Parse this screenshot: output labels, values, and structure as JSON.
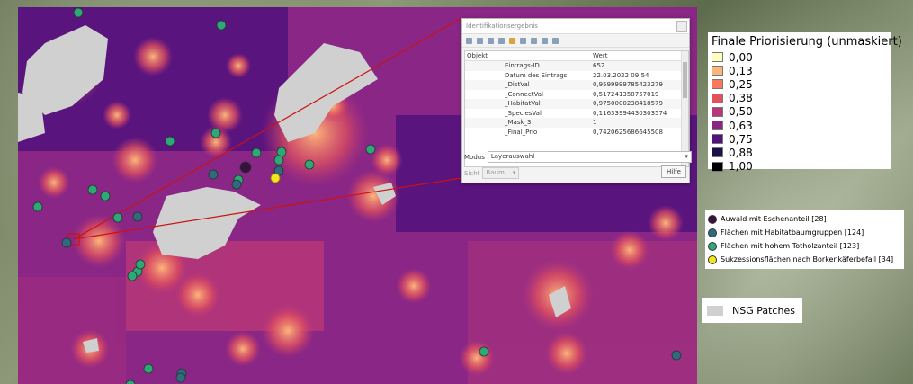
{
  "identify": {
    "title": "Identifikationsergebnis",
    "col_object": "Objekt",
    "col_value": "Wert",
    "rows": [
      {
        "name": "Eintrags-ID",
        "value": "652"
      },
      {
        "name": "Datum des Eintrags",
        "value": "22.03.2022 09:54"
      },
      {
        "name": "_DistVal",
        "value": "0,9599999785423279"
      },
      {
        "name": "_ConnectVal",
        "value": "0,517241358757019"
      },
      {
        "name": "_HabitatVal",
        "value": "0,9750000238418579"
      },
      {
        "name": "_SpeciesVal",
        "value": "0,11633994430303574"
      },
      {
        "name": "_Mask_3",
        "value": "1"
      },
      {
        "name": "_Final_Prio",
        "value": "0,7420625686645508"
      }
    ],
    "mode_label": "Modus",
    "mode_value": "Layerauswahl",
    "view_label": "Sicht",
    "view_value": "Baum",
    "help_label": "Hilfe"
  },
  "legend_prio": {
    "title": "Finale Priorisierung (unmaskiert)",
    "items": [
      {
        "label": "0,00",
        "color": "#fcfdbf"
      },
      {
        "label": "0,13",
        "color": "#fdb57a"
      },
      {
        "label": "0,25",
        "color": "#f9795d"
      },
      {
        "label": "0,38",
        "color": "#e3515c"
      },
      {
        "label": "0,50",
        "color": "#b73779"
      },
      {
        "label": "0,63",
        "color": "#8a2685"
      },
      {
        "label": "0,75",
        "color": "#51127c"
      },
      {
        "label": "0,88",
        "color": "#1d1147"
      },
      {
        "label": "1,00",
        "color": "#000004"
      }
    ]
  },
  "legend_points": {
    "items": [
      {
        "label": "Auwald mit Eschenanteil [28]",
        "color": "#3b0f3f"
      },
      {
        "label": "Flächen mit Habitatbaumgruppen [124]",
        "color": "#2f6a80"
      },
      {
        "label": "Flächen mit hohem Totholzanteil [123]",
        "color": "#2fa878"
      },
      {
        "label": "Sukzessionsflächen nach Borkenkäferbefall [34]",
        "color": "#f2e71b"
      }
    ]
  },
  "legend_nsg": {
    "label": "NSG Patches",
    "color": "#d0d0d0"
  }
}
